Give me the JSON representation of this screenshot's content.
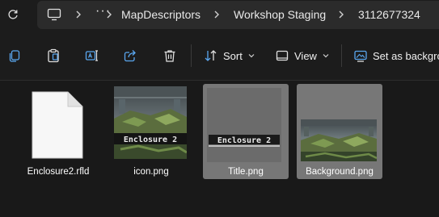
{
  "breadcrumb": {
    "overflow": "···",
    "items": [
      "MapDescriptors",
      "Workshop Staging",
      "3112677324"
    ]
  },
  "toolbar": {
    "sort_label": "Sort",
    "view_label": "View",
    "set_background_label": "Set as backgrou"
  },
  "files": [
    {
      "name": "Enclosure2.rfld",
      "type": "generic-document"
    },
    {
      "name": "icon.png",
      "type": "image",
      "thumb_text": "Enclosure 2"
    },
    {
      "name": "Title.png",
      "type": "image",
      "thumb_text": "Enclosure 2",
      "selected": true
    },
    {
      "name": "Background.png",
      "type": "image",
      "selected": true
    }
  ],
  "colors": {
    "window_bg": "#191919",
    "breadcrumb_bg": "#2b2b2b",
    "selection_bg": "#777777",
    "icon_blue": "#5aa7f0"
  }
}
